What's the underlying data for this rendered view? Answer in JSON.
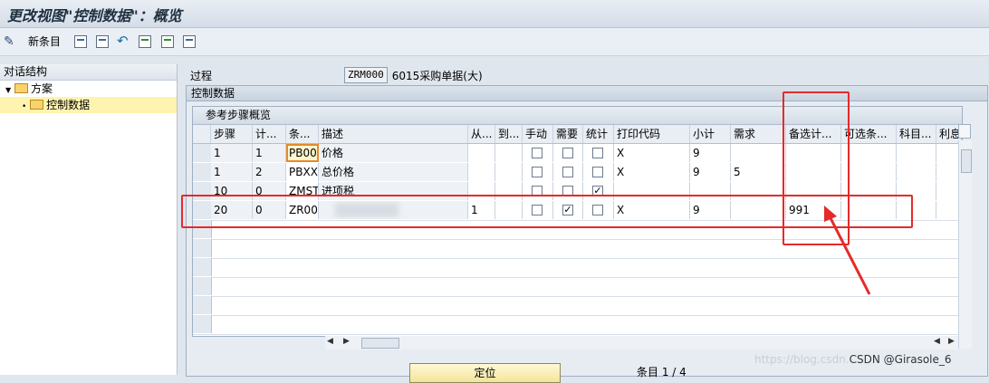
{
  "title": "更改视图\"控制数据\"：概览",
  "toolbar": {
    "new_entries": "新条目"
  },
  "tree": {
    "header": "对话结构",
    "items": [
      {
        "label": "方案"
      },
      {
        "label": "控制数据"
      }
    ]
  },
  "procedure": {
    "label": "过程",
    "value": "ZRM000",
    "description": "6015采购单据(大)"
  },
  "group_title": "控制数据",
  "table": {
    "title": "参考步骤概览",
    "columns": [
      "步骤",
      "计...",
      "条...",
      "描述",
      "从...",
      "到...",
      "手动",
      "需要",
      "统计",
      "打印代码",
      "小计",
      "需求",
      "备选计...",
      "可选条...",
      "科目...",
      "利息"
    ],
    "rows": [
      {
        "step": "1",
        "counter": "1",
        "cond": "PB00",
        "desc": "价格",
        "from": "",
        "to": "",
        "manual": false,
        "required": false,
        "stat": false,
        "print": "X",
        "subtotal": "9",
        "req": "",
        "alt": "",
        "altbase": "",
        "acct": "",
        "accr": ""
      },
      {
        "step": "1",
        "counter": "2",
        "cond": "PBXX",
        "desc": "总价格",
        "from": "",
        "to": "",
        "manual": false,
        "required": false,
        "stat": false,
        "print": "X",
        "subtotal": "9",
        "req": "5",
        "alt": "",
        "altbase": "",
        "acct": "",
        "accr": ""
      },
      {
        "step": "10",
        "counter": "0",
        "cond": "ZMST",
        "desc": "进项税",
        "from": "",
        "to": "",
        "manual": false,
        "required": false,
        "stat": true,
        "print": "",
        "subtotal": "",
        "req": "",
        "alt": "",
        "altbase": "",
        "acct": "",
        "accr": ""
      },
      {
        "step": "20",
        "counter": "0",
        "cond": "ZR00",
        "desc": "",
        "from": "1",
        "to": "",
        "manual": false,
        "required": true,
        "stat": false,
        "print": "X",
        "subtotal": "9",
        "req": "",
        "alt": "991",
        "altbase": "",
        "acct": "",
        "accr": ""
      }
    ]
  },
  "footer": {
    "locate_button": "定位",
    "entry_info": "条目 1 / 4"
  },
  "watermark": {
    "url": "https://blog.csdn.",
    "text": "CSDN @Girasole_6"
  }
}
